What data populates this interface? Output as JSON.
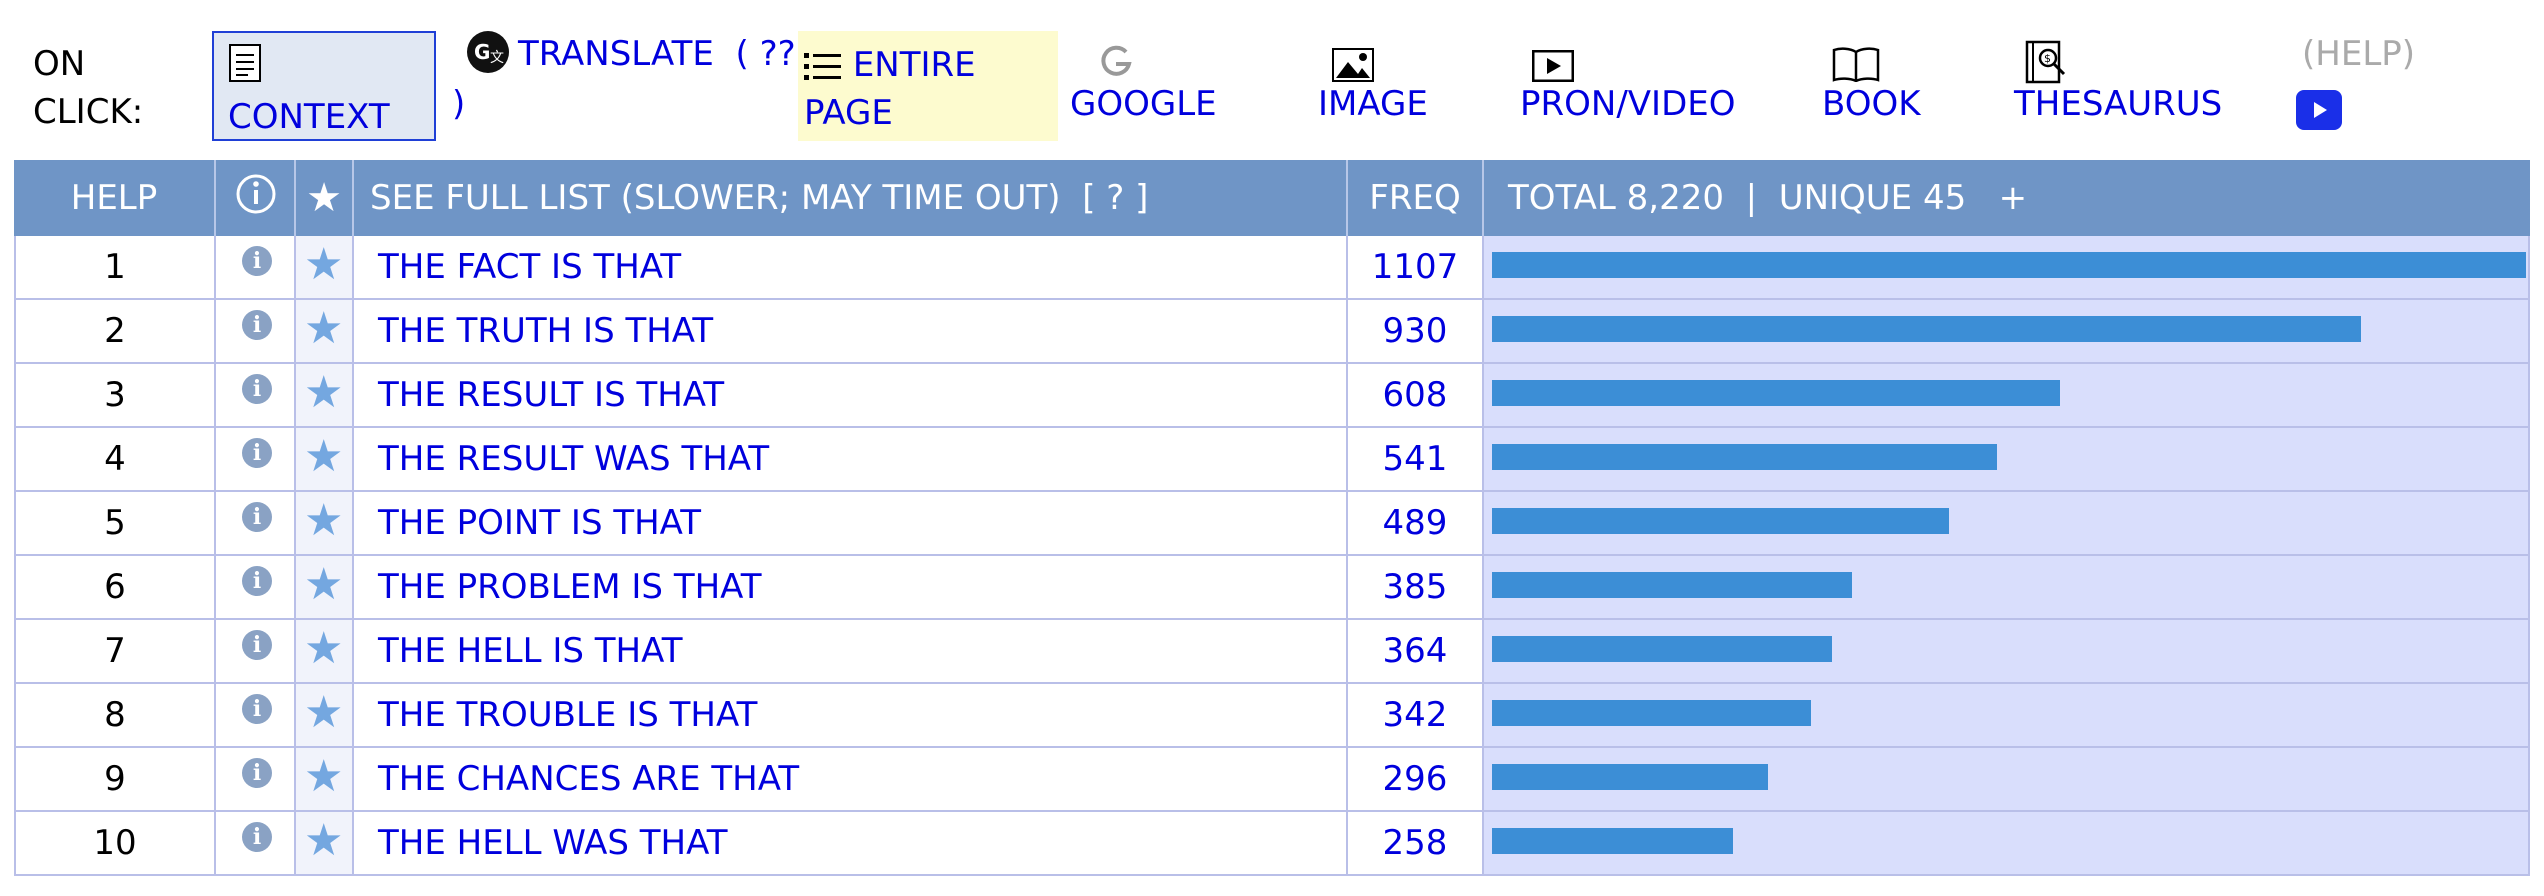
{
  "toolbar": {
    "on_click_line1": "ON",
    "on_click_line2": "CLICK:",
    "context": "CONTEXT",
    "translate": "TRANSLATE",
    "translate_suffix": "( ??",
    "translate_close": ")",
    "entire_line1": "ENTIRE",
    "entire_line2": "PAGE",
    "google": "GOOGLE",
    "image": "IMAGE",
    "pron_video": "PRON/VIDEO",
    "book": "BOOK",
    "thesaurus": "THESAURUS",
    "help": "(HELP)"
  },
  "table": {
    "header": {
      "help": "HELP",
      "info": "ⓘ",
      "star": "★",
      "see_full": "SEE FULL LIST (SLOWER; MAY TIME OUT)  [ ? ]",
      "freq": "FREQ",
      "totals": "TOTAL 8,220  |  UNIQUE 45   +"
    },
    "rows": [
      {
        "num": "1",
        "phrase": "THE FACT IS THAT",
        "freq": 1107
      },
      {
        "num": "2",
        "phrase": "THE TRUTH IS THAT",
        "freq": 930
      },
      {
        "num": "3",
        "phrase": "THE RESULT IS THAT",
        "freq": 608
      },
      {
        "num": "4",
        "phrase": "THE RESULT WAS THAT",
        "freq": 541
      },
      {
        "num": "5",
        "phrase": "THE POINT IS THAT",
        "freq": 489
      },
      {
        "num": "6",
        "phrase": "THE PROBLEM IS THAT",
        "freq": 385
      },
      {
        "num": "7",
        "phrase": "THE HELL IS THAT",
        "freq": 364
      },
      {
        "num": "8",
        "phrase": "THE TROUBLE IS THAT",
        "freq": 342
      },
      {
        "num": "9",
        "phrase": "THE CHANCES ARE THAT",
        "freq": 296
      },
      {
        "num": "10",
        "phrase": "THE HELL WAS THAT",
        "freq": 258
      }
    ]
  },
  "colors": {
    "link": "#0000dd",
    "header_bg": "#6f95c6",
    "bar": "#3c8ed6",
    "bar_bg": "#d9defc"
  }
}
